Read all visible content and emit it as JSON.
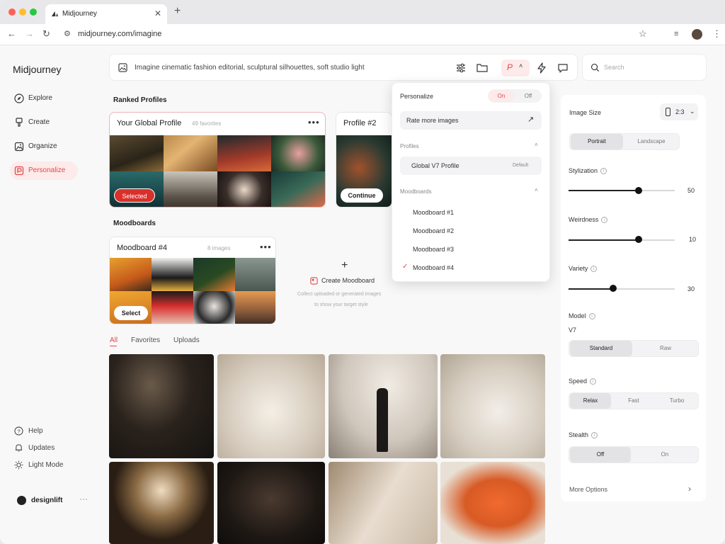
{
  "browser": {
    "tab_title": "Midjourney",
    "url": "midjourney.com/imagine"
  },
  "sidebar": {
    "logo": "Midjourney",
    "items": [
      {
        "label": "Explore",
        "icon": "compass-icon"
      },
      {
        "label": "Create",
        "icon": "brush-icon"
      },
      {
        "label": "Organize",
        "icon": "image-icon"
      },
      {
        "label": "Personalize",
        "icon": "personalize-icon",
        "active": true
      }
    ],
    "bottom": [
      {
        "label": "Help",
        "icon": "help-icon"
      },
      {
        "label": "Updates",
        "icon": "bell-icon"
      },
      {
        "label": "Light Mode",
        "icon": "sun-icon"
      }
    ],
    "user": "designlift"
  },
  "prompt": {
    "text": "Imagine  cinematic fashion editorial, sculptural silhouettes, soft studio light",
    "search_placeholder": "Search",
    "personalize_letter": "P"
  },
  "profiles": {
    "title": "Ranked Profiles",
    "global": {
      "name": "Your Global Profile",
      "meta": "49 favorites",
      "button": "Selected"
    },
    "profile2": {
      "name": "Profile #2",
      "button": "Continue"
    }
  },
  "moodboards": {
    "title": "Moodboards",
    "card": {
      "name": "Moodboard #4",
      "meta": "8 images",
      "button": "Select"
    },
    "create": {
      "plus": "+",
      "label": "Create Moodboard",
      "desc_line1": "Collect uploaded or generated images",
      "desc_line2": "to show your target style"
    }
  },
  "filters": [
    "All",
    "Favorites",
    "Uploads"
  ],
  "dropdown": {
    "title": "Personalize",
    "on": "On",
    "off": "Off",
    "rate": "Rate more images",
    "profiles_header": "Profiles",
    "profile_item": "Global V7 Profile",
    "profile_tag": "Default",
    "moodboards_header": "Moodboards",
    "moodboard_items": [
      "Moodboard #1",
      "Moodboard #2",
      "Moodboard #3",
      "Moodboard #4"
    ],
    "checked_index": 3
  },
  "settings": {
    "image_size": {
      "label": "Image Size",
      "ratio": "2:3",
      "options": [
        "Portrait",
        "Landscape"
      ],
      "selected": 0
    },
    "stylization": {
      "label": "Stylization",
      "value": "50",
      "fraction": 0.66
    },
    "weirdness": {
      "label": "Weirdness",
      "value": "10",
      "fraction": 0.66
    },
    "variety": {
      "label": "Variety",
      "value": "30",
      "fraction": 0.42
    },
    "model": {
      "label": "Model",
      "version": "V7",
      "options": [
        "Standard",
        "Raw"
      ],
      "selected": 0
    },
    "speed": {
      "label": "Speed",
      "options": [
        "Relax",
        "Fast",
        "Turbo"
      ],
      "selected": 0
    },
    "stealth": {
      "label": "Stealth",
      "options": [
        "Off",
        "On"
      ],
      "selected": 0
    },
    "more": "More Options"
  },
  "colors": {
    "accent": "#e24a4a",
    "accent_bg": "#fdeaea",
    "selected_button": "#d9302b"
  }
}
